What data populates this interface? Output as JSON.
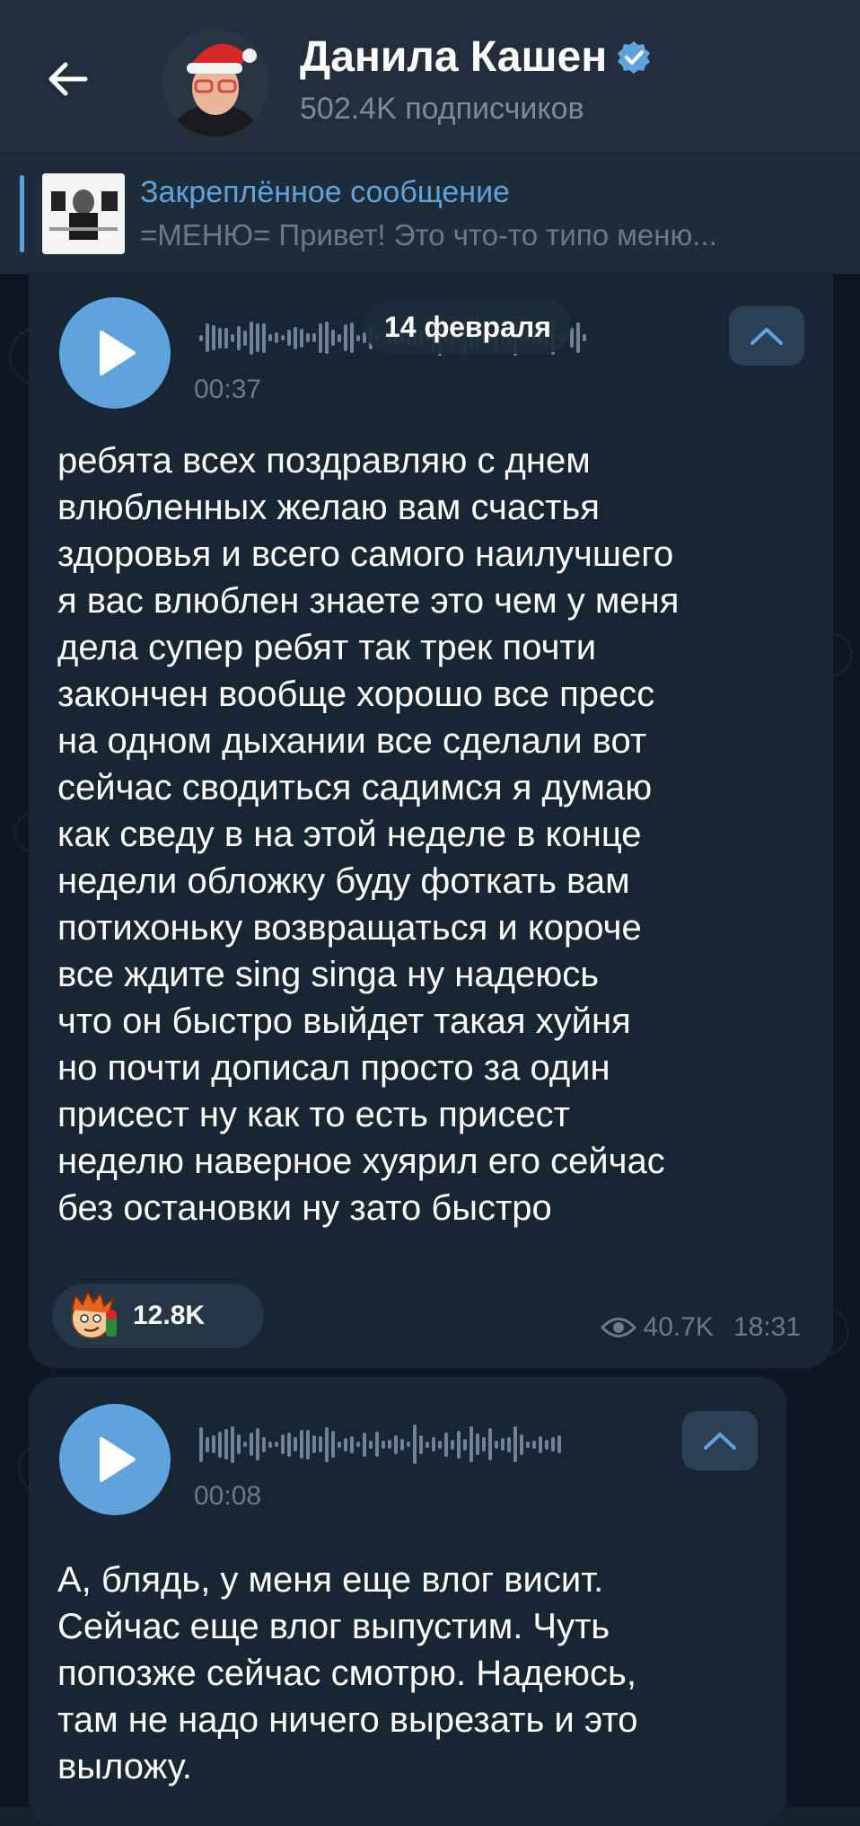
{
  "header": {
    "title": "Данила Кашен",
    "subscribers": "502.4K подписчиков"
  },
  "pinned": {
    "title": "Закреплённое сообщение",
    "text": "=МЕНЮ=  Привет! Это что-то типо меню..."
  },
  "date_pill": "14 февраля",
  "messages": [
    {
      "duration": "00:37",
      "transcript": "ребята всех поздравляю с днем\nвлюбленных желаю вам счастья\nздоровья и всего самого наилучшего\nя вас влюблен знаете это чем у меня\nдела супер ребят так трек почти\nзакончен вообще хорошо все пресс\nна одном дыхании все сделали вот\nсейчас сводиться садимся я думаю\nкак сведу в на этой неделе в конце\nнедели обложку буду фоткать вам\nпотихоньку возвращаться и короче\nвсе ждите sing singa ну надеюсь\nчто он быстро выйдет такая хуйня\nно почти дописал просто за один\nприсест ну как то есть присест\nнеделю наверное хуярил его сейчас\nбез остановки ну зато быстро",
      "reaction_count": "12.8K",
      "views": "40.7K",
      "time": "18:31"
    },
    {
      "duration": "00:08",
      "transcript": "А, блядь, у меня еще влог висит.\nСейчас еще влог выпустим. Чуть\nпопозже сейчас смотрю. Надеюсь,\nтам не надо ничего вырезать и это\nвыложу."
    }
  ],
  "colors": {
    "accent": "#5fa3de",
    "bubble": "#182533",
    "header": "#232e3c"
  },
  "icons": [
    "back-arrow-icon",
    "verified-icon",
    "play-icon",
    "chevron-up-icon",
    "eye-icon",
    "reaction-emoji-icon"
  ]
}
